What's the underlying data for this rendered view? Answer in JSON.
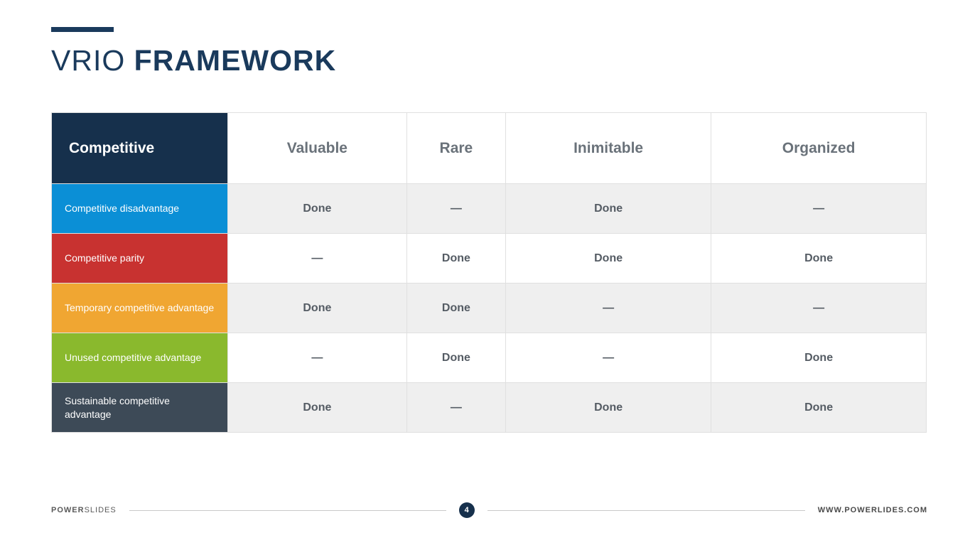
{
  "title_part1": "VRIO",
  "title_part2": "FRAMEWORK",
  "chart_data": {
    "type": "table",
    "header": {
      "first": "Competitive",
      "columns": [
        "Valuable",
        "Rare",
        "Inimitable",
        "Organized"
      ]
    },
    "rows": [
      {
        "label": "Competitive disadvantage",
        "color": "blue",
        "cells": [
          "Done",
          "—",
          "Done",
          "—"
        ]
      },
      {
        "label": "Competitive parity",
        "color": "red",
        "cells": [
          "—",
          "Done",
          "Done",
          "Done"
        ]
      },
      {
        "label": "Temporary competitive advantage",
        "color": "orange",
        "cells": [
          "Done",
          "Done",
          "—",
          "—"
        ]
      },
      {
        "label": "Unused competitive advantage",
        "color": "green",
        "cells": [
          "—",
          "Done",
          "—",
          "Done"
        ]
      },
      {
        "label": "Sustainable competitive advantage",
        "color": "slate",
        "cells": [
          "Done",
          "—",
          "Done",
          "Done"
        ]
      }
    ]
  },
  "footer": {
    "brand_strong": "POWER",
    "brand_light": "SLIDES",
    "page": "4",
    "url": "WWW.POWERLIDES.COM"
  }
}
